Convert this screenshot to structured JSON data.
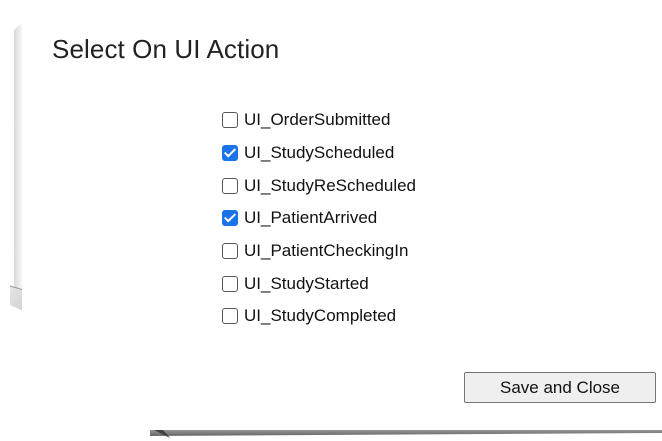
{
  "dialog": {
    "title": "Select On UI Action"
  },
  "options": [
    {
      "label": "UI_OrderSubmitted",
      "checked": false
    },
    {
      "label": "UI_StudyScheduled",
      "checked": true
    },
    {
      "label": "UI_StudyReScheduled",
      "checked": false
    },
    {
      "label": "UI_PatientArrived",
      "checked": true
    },
    {
      "label": "UI_PatientCheckingIn",
      "checked": false
    },
    {
      "label": "UI_StudyStarted",
      "checked": false
    },
    {
      "label": "UI_StudyCompleted",
      "checked": false
    }
  ],
  "footer": {
    "save_label": "Save and Close"
  },
  "colors": {
    "checkbox_checked": "#1a73e8",
    "button_bg": "#efefef"
  }
}
